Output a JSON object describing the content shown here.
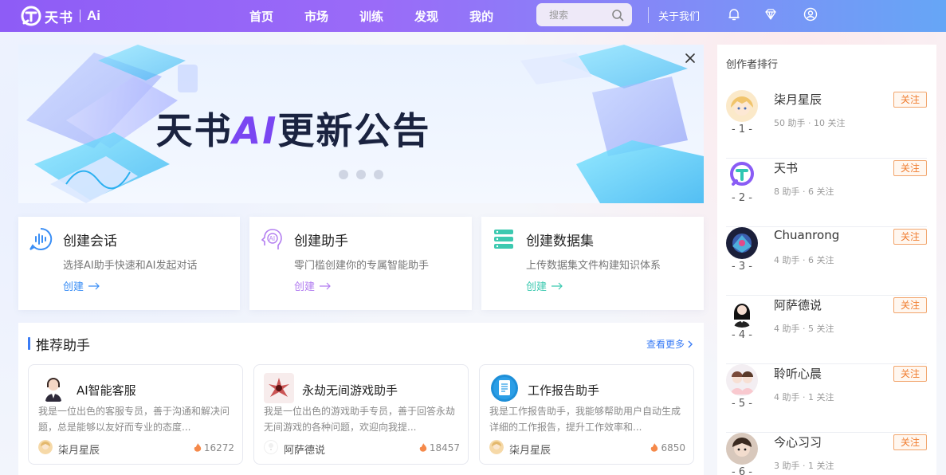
{
  "nav": {
    "logo_text": "天书",
    "logo_ai": "Ai",
    "menu": [
      "首页",
      "市场",
      "训练",
      "发现",
      "我的"
    ],
    "search_placeholder": "搜索",
    "about": "关于我们",
    "icons": [
      "bell-icon",
      "diamond-icon",
      "user-circle-icon"
    ]
  },
  "banner": {
    "title_pre": "天书",
    "title_ai": "AI",
    "title_post": "更新公告",
    "slide_count": 3
  },
  "actions": [
    {
      "title": "创建会话",
      "desc": "选择AI助手快速和AI发起对话",
      "link": "创建",
      "color": "#3a8ef5",
      "icon": "voice-chat-icon"
    },
    {
      "title": "创建助手",
      "desc": "零门槛创建你的专属智能助手",
      "link": "创建",
      "color": "#b27df0",
      "icon": "ai-head-icon"
    },
    {
      "title": "创建数据集",
      "desc": "上传数据集文件构建知识体系",
      "link": "创建",
      "color": "#3cc9b0",
      "icon": "database-icon"
    }
  ],
  "recommend": {
    "title": "推荐助手",
    "more": "查看更多",
    "cards": [
      {
        "name": "AI智能客服",
        "desc": "我是一位出色的客服专员，善于沟通和解决问题，总是能够以友好而专业的态度...",
        "author": "柒月星辰",
        "heat": "16272"
      },
      {
        "name": "永劫无间游戏助手",
        "desc": "我是一位出色的游戏助手专员，善于回答永劫无间游戏的各种问题，欢迎向我提...",
        "author": "阿萨德说",
        "heat": "18457"
      },
      {
        "name": "工作报告助手",
        "desc": "我是工作报告助手，我能够帮助用户自动生成详细的工作报告，提升工作效率和...",
        "author": "柒月星辰",
        "heat": "6850"
      }
    ]
  },
  "ranking": {
    "title": "创作者排行",
    "follow_label": "关注",
    "items": [
      {
        "rank": "- 1 -",
        "name": "柒月星辰",
        "stats": "50 助手 · 10 关注"
      },
      {
        "rank": "- 2 -",
        "name": "天书",
        "stats": "8 助手 · 6 关注"
      },
      {
        "rank": "- 3 -",
        "name": "Chuanrong",
        "stats": "4 助手 · 6 关注"
      },
      {
        "rank": "- 4 -",
        "name": "阿萨德说",
        "stats": "4 助手 · 5 关注"
      },
      {
        "rank": "- 5 -",
        "name": "聆听心晨",
        "stats": "4 助手 · 1 关注"
      },
      {
        "rank": "- 6 -",
        "name": "今心习习",
        "stats": "3 助手 · 1 关注"
      }
    ]
  }
}
